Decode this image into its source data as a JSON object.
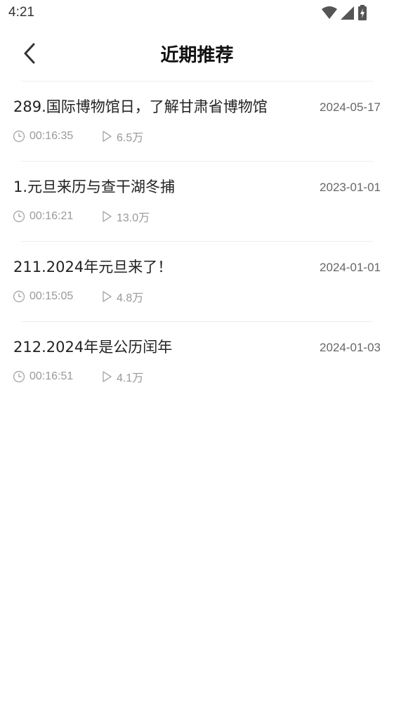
{
  "status_bar": {
    "time": "4:21",
    "icons": [
      "wifi-icon",
      "cellular-signal-icon",
      "battery-charging-icon"
    ]
  },
  "header": {
    "title": "近期推荐",
    "back_icon": "chevron-left-icon"
  },
  "items": [
    {
      "title": "289.国际博物馆日，了解甘肃省博物馆",
      "date": "2024-05-17",
      "duration": "00:16:35",
      "plays": "6.5万"
    },
    {
      "title": "1.元旦来历与查干湖冬捕",
      "date": "2023-01-01",
      "duration": "00:16:21",
      "plays": "13.0万"
    },
    {
      "title": "211.2024年元旦来了！",
      "date": "2024-01-01",
      "duration": "00:15:05",
      "plays": "4.8万"
    },
    {
      "title": "212.2024年是公历闰年",
      "date": "2024-01-03",
      "duration": "00:16:51",
      "plays": "4.1万"
    }
  ],
  "colors": {
    "title_text": "#111111",
    "item_text": "#222222",
    "date_text": "#666666",
    "meta_text": "#999999",
    "divider": "#eeeeee"
  }
}
